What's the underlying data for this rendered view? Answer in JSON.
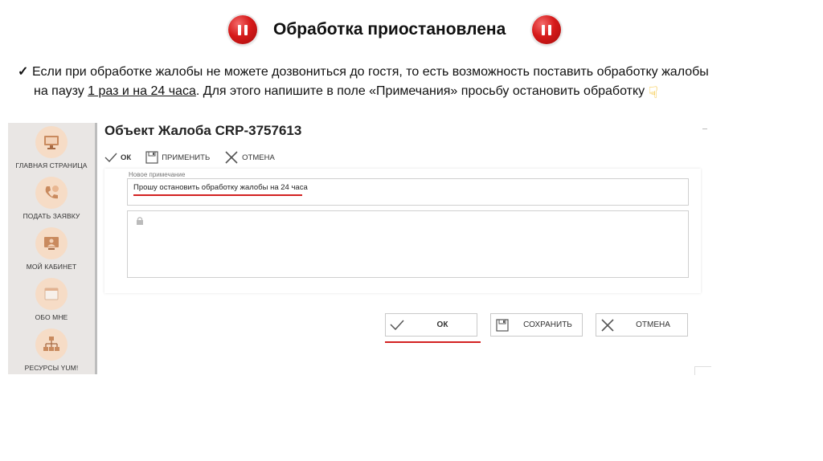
{
  "slide": {
    "title": "Обработка приостановлена",
    "intro_check": "✓",
    "intro_line1": "Если при обработке жалобы не можете дозвониться до гостя, то есть возможность поставить обработку жалобы",
    "intro_line2_pre": "на паузу ",
    "intro_line2_underlined": "1 раз и на 24 часа",
    "intro_line2_post": ". Для этого напишите в поле «Примечания» просьбу остановить обработку"
  },
  "sidebar": {
    "items": [
      {
        "label": "ГЛАВНАЯ СТРАНИЦА",
        "icon": "monitor-icon"
      },
      {
        "label": "ПОДАТЬ ЗАЯВКУ",
        "icon": "phone-icon"
      },
      {
        "label": "МОЙ КАБИНЕТ",
        "icon": "user-screen-icon"
      },
      {
        "label": "ОБО МНЕ",
        "icon": "calendar-icon"
      },
      {
        "label": "РЕСУРСЫ YUM!",
        "icon": "network-icon"
      }
    ]
  },
  "form": {
    "title": "Объект Жалоба CRP-3757613",
    "toolbar": {
      "ok": "ОК",
      "apply": "ПРИМЕНИТЬ",
      "cancel": "ОТМЕНА"
    },
    "note_label": "Новое примечание",
    "note_value": "Прошу остановить обработку жалобы на 24 часа"
  },
  "footer_buttons": {
    "ok": "ОК",
    "save": "СОХРАНИТЬ",
    "cancel": "ОТМЕНА"
  },
  "colors": {
    "accent_red": "#d32121",
    "sidebar_bg": "#e9e6e4",
    "icon_circle": "#f6dcc6"
  }
}
